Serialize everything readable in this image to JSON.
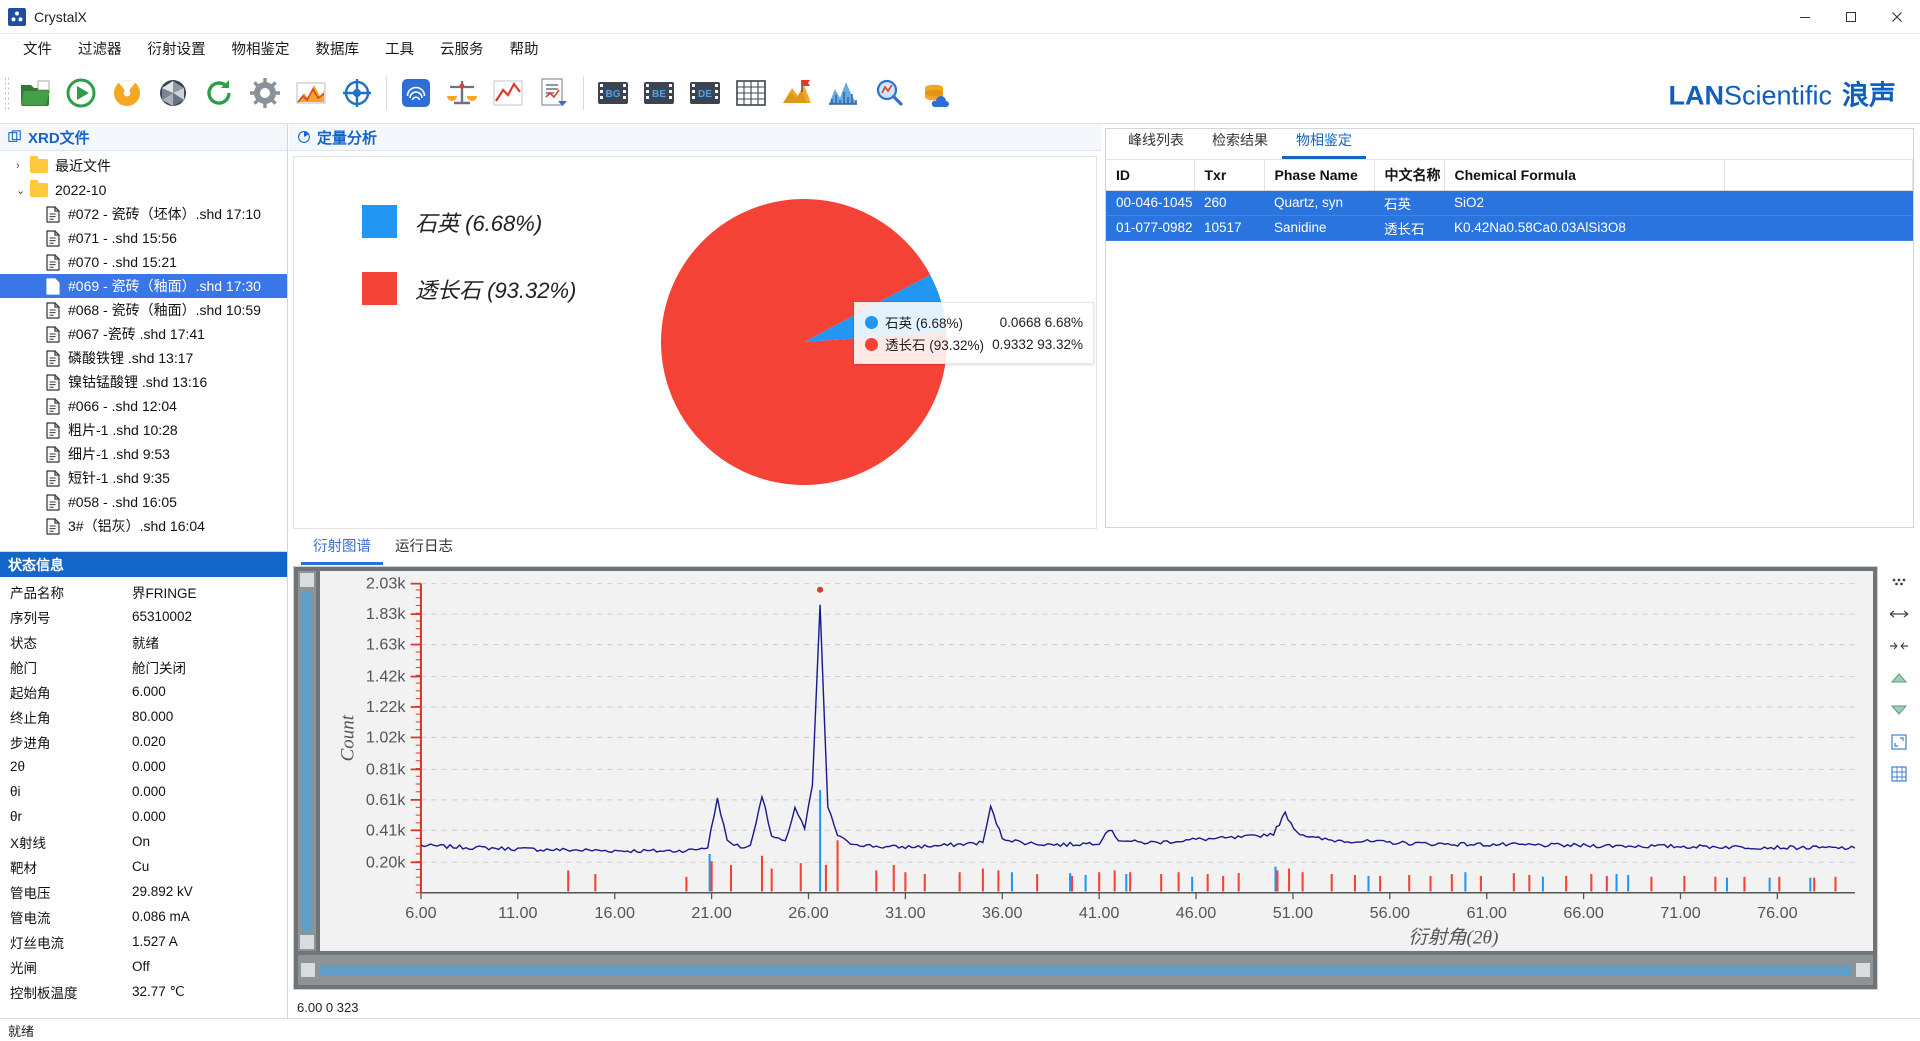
{
  "window": {
    "title": "CrystalX",
    "app_icon": "crystalx-logo-icon",
    "minimize": "─",
    "maximize": "☐",
    "close": "✕"
  },
  "menubar": {
    "items": [
      {
        "label": "文件",
        "name": "menu-file"
      },
      {
        "label": "过滤器",
        "name": "menu-filter"
      },
      {
        "label": "衍射设置",
        "name": "menu-diffraction-settings"
      },
      {
        "label": "物相鉴定",
        "name": "menu-phase-identification"
      },
      {
        "label": "数据库",
        "name": "menu-database"
      },
      {
        "label": "工具",
        "name": "menu-tools"
      },
      {
        "label": "云服务",
        "name": "menu-cloud-service"
      },
      {
        "label": "帮助",
        "name": "menu-help"
      }
    ]
  },
  "toolbar": {
    "buttons": [
      {
        "name": "open-file-icon",
        "glyph": "folder-open"
      },
      {
        "name": "start-measurement-icon",
        "glyph": "play"
      },
      {
        "name": "stop-measurement-icon",
        "glyph": "radiation"
      },
      {
        "name": "aperture-icon",
        "glyph": "aperture"
      },
      {
        "name": "refresh-icon",
        "glyph": "refresh"
      },
      {
        "name": "settings-gear-icon",
        "glyph": "gear"
      },
      {
        "name": "pattern-chart-icon",
        "glyph": "mountain-chart"
      },
      {
        "name": "goniometer-icon",
        "glyph": "crosshair"
      },
      {
        "name": "fingerprint-search-icon",
        "glyph": "fingerprint"
      },
      {
        "name": "balance-scale-icon",
        "glyph": "scale"
      },
      {
        "name": "line-chart-icon",
        "glyph": "line-chart"
      },
      {
        "name": "report-export-icon",
        "glyph": "report"
      },
      {
        "name": "background-bg-icon",
        "glyph": "BG"
      },
      {
        "name": "background-be-icon",
        "glyph": "BE"
      },
      {
        "name": "background-de-icon",
        "glyph": "DE"
      },
      {
        "name": "grid-table-icon",
        "glyph": "grid"
      },
      {
        "name": "peak-flag-icon",
        "glyph": "flag-mountain"
      },
      {
        "name": "spectrum-compare-icon",
        "glyph": "spectrum"
      },
      {
        "name": "zoom-search-icon",
        "glyph": "magnifier"
      },
      {
        "name": "cloud-database-icon",
        "glyph": "cloud-db"
      }
    ],
    "brand_lan": "LAN",
    "brand_sci": "Scientific",
    "brand_cn": "浪声"
  },
  "xrd_panel": {
    "title": "XRD文件",
    "icon": "window-copy-icon",
    "tree": [
      {
        "type": "folder",
        "label": "最近文件",
        "expanded": false,
        "chevron": "›"
      },
      {
        "type": "folder",
        "label": "2022-10",
        "expanded": true,
        "chevron": "⌄"
      },
      {
        "type": "file",
        "label": "#072 - 瓷砖（坯体）.shd 17:10",
        "selected": false
      },
      {
        "type": "file",
        "label": "#071 - .shd 15:56",
        "selected": false
      },
      {
        "type": "file",
        "label": "#070 - .shd 15:21",
        "selected": false
      },
      {
        "type": "file",
        "label": "#069 - 瓷砖（釉面）.shd 17:30",
        "selected": true
      },
      {
        "type": "file",
        "label": "#068 - 瓷砖（釉面）.shd 10:59",
        "selected": false
      },
      {
        "type": "file",
        "label": "#067 -瓷砖 .shd 17:41",
        "selected": false
      },
      {
        "type": "file",
        "label": "磷酸铁锂 .shd 13:17",
        "selected": false
      },
      {
        "type": "file",
        "label": "镍钴锰酸锂 .shd 13:16",
        "selected": false
      },
      {
        "type": "file",
        "label": "#066 - .shd 12:04",
        "selected": false
      },
      {
        "type": "file",
        "label": "粗片-1 .shd 10:28",
        "selected": false
      },
      {
        "type": "file",
        "label": "细片-1 .shd 9:53",
        "selected": false
      },
      {
        "type": "file",
        "label": "短针-1 .shd 9:35",
        "selected": false
      },
      {
        "type": "file",
        "label": "#058 - .shd 16:05",
        "selected": false
      },
      {
        "type": "file",
        "label": "3#（铝灰）.shd 16:04",
        "selected": false
      }
    ]
  },
  "status_panel": {
    "title": "状态信息",
    "rows": [
      {
        "key": "产品名称",
        "value": "界FRINGE"
      },
      {
        "key": "序列号",
        "value": "65310002"
      },
      {
        "key": "状态",
        "value": "就绪"
      },
      {
        "key": "舱门",
        "value": "舱门关闭"
      },
      {
        "key": "起始角",
        "value": "6.000"
      },
      {
        "key": "终止角",
        "value": "80.000"
      },
      {
        "key": "步进角",
        "value": "0.020"
      },
      {
        "key": "2θ",
        "value": "0.000"
      },
      {
        "key": "θi",
        "value": "0.000"
      },
      {
        "key": "θr",
        "value": "0.000"
      },
      {
        "key": "X射线",
        "value": "On"
      },
      {
        "key": "靶材",
        "value": "Cu"
      },
      {
        "key": "管电压",
        "value": "29.892 kV"
      },
      {
        "key": "管电流",
        "value": "0.086 mA"
      },
      {
        "key": "灯丝电流",
        "value": "1.527 A"
      },
      {
        "key": "光闸",
        "value": "Off"
      },
      {
        "key": "控制板温度",
        "value": "32.77 ℃"
      }
    ]
  },
  "quant_panel": {
    "title": "定量分析",
    "icon": "quant-analysis-icon",
    "tooltip": {
      "rows": [
        {
          "name": "石英 (6.68%)",
          "fraction": "0.0668",
          "percent": "6.68%",
          "color": "#2196f3"
        },
        {
          "name": "透长石 (93.32%)",
          "fraction": "0.9332",
          "percent": "93.32%",
          "color": "#f44336"
        }
      ]
    }
  },
  "chart_data": [
    {
      "type": "pie",
      "title": "定量分析",
      "labels": [
        "石英 (6.68%)",
        "透长石 (93.32%)"
      ],
      "values": [
        6.68,
        93.32
      ],
      "colors": [
        "#2196f3",
        "#f44336"
      ],
      "legend_position": "left",
      "start_angle_deg": -28,
      "annotations": [
        "石英 0.0668 6.68%",
        "透长石 0.9332 93.32%"
      ]
    },
    {
      "type": "line",
      "title": "衍射图谱",
      "xlabel": "衍射角(2θ)",
      "ylabel": "Count",
      "xlim": [
        6.0,
        80.0
      ],
      "ylim": [
        0,
        2030
      ],
      "grid": true,
      "x_ticks": [
        "6.00",
        "11.00",
        "16.00",
        "21.00",
        "26.00",
        "31.00",
        "36.00",
        "41.00",
        "46.00",
        "51.00",
        "56.00",
        "61.00",
        "66.00",
        "71.00",
        "76.00"
      ],
      "y_ticks": [
        "0.20k",
        "0.41k",
        "0.61k",
        "0.81k",
        "1.02k",
        "1.22k",
        "1.42k",
        "1.63k",
        "1.83k",
        "2.03k"
      ],
      "y_tick_values": [
        200,
        410,
        610,
        810,
        1020,
        1220,
        1420,
        1630,
        1830,
        2030
      ],
      "series": [
        {
          "name": "measured-pattern",
          "color": "#1a1a8c",
          "points": [
            [
              6.0,
              310
            ],
            [
              7.0,
              305
            ],
            [
              8.0,
              300
            ],
            [
              9.0,
              295
            ],
            [
              10.0,
              292
            ],
            [
              11.0,
              288
            ],
            [
              12.0,
              285
            ],
            [
              13.0,
              282
            ],
            [
              14.0,
              280
            ],
            [
              15.0,
              278
            ],
            [
              16.0,
              276
            ],
            [
              17.0,
              275
            ],
            [
              18.0,
              274
            ],
            [
              19.0,
              275
            ],
            [
              20.0,
              280
            ],
            [
              20.8,
              300
            ],
            [
              21.3,
              620
            ],
            [
              21.8,
              340
            ],
            [
              22.5,
              300
            ],
            [
              23.0,
              305
            ],
            [
              23.6,
              640
            ],
            [
              24.1,
              370
            ],
            [
              24.8,
              330
            ],
            [
              25.3,
              560
            ],
            [
              25.8,
              420
            ],
            [
              26.2,
              700
            ],
            [
              26.6,
              1880
            ],
            [
              27.0,
              560
            ],
            [
              27.5,
              380
            ],
            [
              28.0,
              330
            ],
            [
              29.0,
              310
            ],
            [
              30.0,
              300
            ],
            [
              31.0,
              300
            ],
            [
              32.0,
              305
            ],
            [
              33.0,
              310
            ],
            [
              34.0,
              320
            ],
            [
              35.0,
              330
            ],
            [
              35.4,
              560
            ],
            [
              36.0,
              360
            ],
            [
              37.0,
              330
            ],
            [
              38.0,
              320
            ],
            [
              39.0,
              315
            ],
            [
              40.0,
              320
            ],
            [
              41.0,
              330
            ],
            [
              41.5,
              420
            ],
            [
              42.0,
              350
            ],
            [
              43.0,
              330
            ],
            [
              44.0,
              330
            ],
            [
              45.0,
              340
            ],
            [
              46.0,
              350
            ],
            [
              47.0,
              355
            ],
            [
              48.0,
              360
            ],
            [
              49.0,
              370
            ],
            [
              50.0,
              390
            ],
            [
              50.6,
              520
            ],
            [
              51.2,
              400
            ],
            [
              52.0,
              360
            ],
            [
              53.0,
              345
            ],
            [
              54.0,
              340
            ],
            [
              55.0,
              335
            ],
            [
              56.0,
              330
            ],
            [
              57.0,
              325
            ],
            [
              58.0,
              322
            ],
            [
              59.0,
              320
            ],
            [
              60.0,
              318
            ],
            [
              62.0,
              315
            ],
            [
              64.0,
              312
            ],
            [
              66.0,
              310
            ],
            [
              68.0,
              308
            ],
            [
              70.0,
              305
            ],
            [
              72.0,
              303
            ],
            [
              74.0,
              300
            ],
            [
              76.0,
              298
            ],
            [
              78.0,
              295
            ],
            [
              80.0,
              293
            ]
          ]
        }
      ],
      "stick_patterns": [
        {
          "name": "quartz-sticks",
          "color": "#2196f3",
          "peaks": [
            [
              20.9,
              0.3
            ],
            [
              26.6,
              1.0
            ],
            [
              36.5,
              0.1
            ],
            [
              39.5,
              0.09
            ],
            [
              40.3,
              0.07
            ],
            [
              42.4,
              0.08
            ],
            [
              45.8,
              0.05
            ],
            [
              50.1,
              0.16
            ],
            [
              54.9,
              0.06
            ],
            [
              59.9,
              0.1
            ],
            [
              63.9,
              0.05
            ],
            [
              67.7,
              0.08
            ],
            [
              68.3,
              0.07
            ],
            [
              73.4,
              0.04
            ],
            [
              75.6,
              0.04
            ],
            [
              77.7,
              0.04
            ]
          ]
        },
        {
          "name": "sanidine-sticks",
          "color": "#f44336",
          "peaks": [
            [
              13.6,
              0.12
            ],
            [
              15.0,
              0.08
            ],
            [
              19.7,
              0.05
            ],
            [
              21.0,
              0.22
            ],
            [
              22.0,
              0.18
            ],
            [
              23.6,
              0.28
            ],
            [
              24.1,
              0.14
            ],
            [
              25.6,
              0.2
            ],
            [
              26.9,
              0.18
            ],
            [
              27.5,
              0.45
            ],
            [
              29.5,
              0.12
            ],
            [
              30.4,
              0.18
            ],
            [
              31.0,
              0.1
            ],
            [
              32.0,
              0.08
            ],
            [
              33.8,
              0.1
            ],
            [
              35.0,
              0.14
            ],
            [
              35.8,
              0.12
            ],
            [
              37.8,
              0.08
            ],
            [
              39.6,
              0.06
            ],
            [
              41.0,
              0.1
            ],
            [
              41.8,
              0.12
            ],
            [
              42.6,
              0.1
            ],
            [
              44.2,
              0.08
            ],
            [
              45.1,
              0.1
            ],
            [
              46.6,
              0.08
            ],
            [
              47.4,
              0.06
            ],
            [
              48.2,
              0.09
            ],
            [
              50.2,
              0.12
            ],
            [
              50.8,
              0.14
            ],
            [
              51.5,
              0.1
            ],
            [
              53.0,
              0.08
            ],
            [
              54.2,
              0.07
            ],
            [
              55.5,
              0.06
            ],
            [
              57.0,
              0.07
            ],
            [
              58.1,
              0.06
            ],
            [
              59.2,
              0.08
            ],
            [
              60.7,
              0.06
            ],
            [
              62.4,
              0.09
            ],
            [
              63.2,
              0.07
            ],
            [
              65.1,
              0.06
            ],
            [
              66.4,
              0.08
            ],
            [
              67.2,
              0.06
            ],
            [
              69.5,
              0.05
            ],
            [
              71.2,
              0.06
            ],
            [
              72.8,
              0.05
            ],
            [
              74.3,
              0.05
            ],
            [
              76.1,
              0.05
            ],
            [
              77.9,
              0.04
            ],
            [
              79.0,
              0.05
            ]
          ]
        }
      ]
    }
  ],
  "phase_panel": {
    "tabs": [
      {
        "label": "峰线列表",
        "active": false
      },
      {
        "label": "检索结果",
        "active": false
      },
      {
        "label": "物相鉴定",
        "active": true
      }
    ],
    "columns": [
      "ID",
      "Txr",
      "Phase Name",
      "中文名称",
      "Chemical Formula",
      ""
    ],
    "rows": [
      {
        "id": "00-046-1045",
        "txr": "260",
        "phase_name": "Quartz, syn",
        "cn_name": "石英",
        "formula": "SiO2",
        "extra": ""
      },
      {
        "id": "01-077-0982",
        "txr": "10517",
        "phase_name": "Sanidine",
        "cn_name": "透长石",
        "formula": "K0.42Na0.58Ca0.03AlSi3O8",
        "extra": ""
      }
    ]
  },
  "bottom_panel": {
    "tabs": [
      {
        "label": "衍射图谱",
        "active": true
      },
      {
        "label": "运行日志",
        "active": false
      }
    ],
    "plot_status": "6.00  0  323",
    "right_tools": [
      {
        "name": "more-options-icon",
        "glyph": "dots"
      },
      {
        "name": "fit-horizontal-icon",
        "glyph": "arrows-h"
      },
      {
        "name": "shrink-right-icon",
        "glyph": "arrows-in"
      },
      {
        "name": "scroll-up-icon",
        "glyph": "triangle-up"
      },
      {
        "name": "scroll-down-icon",
        "glyph": "triangle-down"
      },
      {
        "name": "fullscreen-icon",
        "glyph": "expand"
      },
      {
        "name": "grid-toggle-icon",
        "glyph": "grid"
      }
    ]
  },
  "statusbar": {
    "text": "就绪"
  },
  "colors": {
    "accent": "#1464c8",
    "selection": "#3a76e8",
    "quartz": "#2196f3",
    "sanidine": "#f44336",
    "plot_line": "#1a1a8c"
  }
}
